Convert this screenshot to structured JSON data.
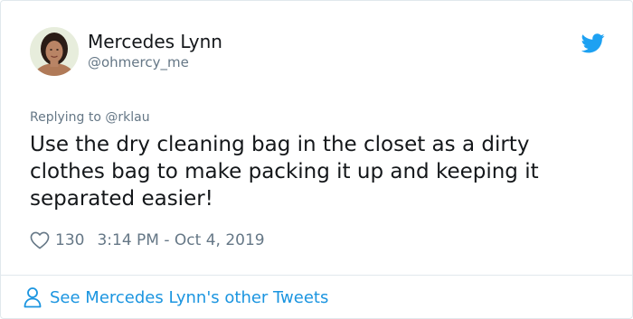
{
  "tweet": {
    "author": {
      "name": "Mercedes Lynn",
      "handle": "@ohmercy_me",
      "avatar_icon": "profile-photo"
    },
    "brand_icon": "twitter-bird-icon",
    "brand_color": "#1da1f2",
    "replying_prefix": "Replying to",
    "replying_to": "@rklau",
    "text": "Use the dry cleaning bag in the closet as a dirty clothes bag to make packing it up and keeping it separated easier!",
    "like_icon": "heart-icon",
    "likes": "130",
    "timestamp": "3:14 PM - Oct 4, 2019",
    "footer_icon": "person-icon",
    "footer_link": "See Mercedes Lynn's other Tweets",
    "link_color": "#1b95e0"
  }
}
